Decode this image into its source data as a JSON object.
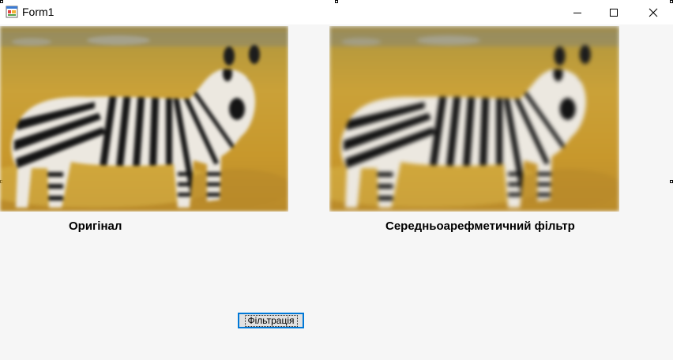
{
  "window": {
    "title": "Form1"
  },
  "images": {
    "original_label": "Оригінал",
    "filtered_label": "Середньоарефметичний фільтр"
  },
  "actions": {
    "filter_button_label": "Фільтрація"
  },
  "icons": {
    "app": "winforms-app-icon",
    "minimize": "minimize-icon",
    "maximize": "maximize-icon",
    "close": "close-icon"
  },
  "colors": {
    "button_focus_border": "#0078d7",
    "form_background": "#f6f6f6"
  }
}
